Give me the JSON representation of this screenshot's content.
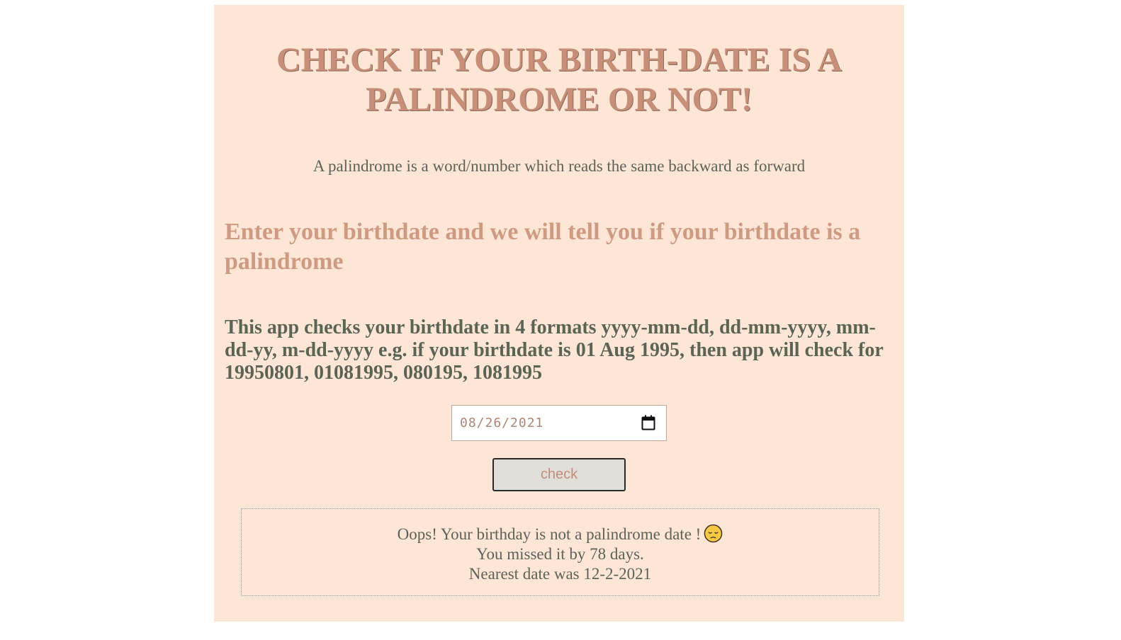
{
  "header": {
    "title": "CHECK IF YOUR BIRTH-DATE IS A PALINDROME OR NOT!"
  },
  "intro": {
    "definition": "A palindrome is a word/number which reads the same backward as forward",
    "prompt": "Enter your birthdate and we will tell you if your birthdate is a palindrome",
    "formats": "This app checks your birthdate in 4 formats yyyy-mm-dd, dd-mm-yyyy, mm-dd-yy, m-dd-yyyy e.g. if your birthdate is 01 Aug 1995, then app will check for 19950801, 01081995, 080195, 1081995"
  },
  "form": {
    "date_value": "08/26/2021",
    "check_label": "check"
  },
  "result": {
    "line1": "Oops! Your birthday is not a palindrome date !",
    "line2": "You missed it by 78 days.",
    "line3": "Nearest date was 12-2-2021",
    "emoji": "pensive-face-icon"
  },
  "colors": {
    "background": "#fee6d7",
    "accent": "#c78f77",
    "text": "#5d6258"
  }
}
